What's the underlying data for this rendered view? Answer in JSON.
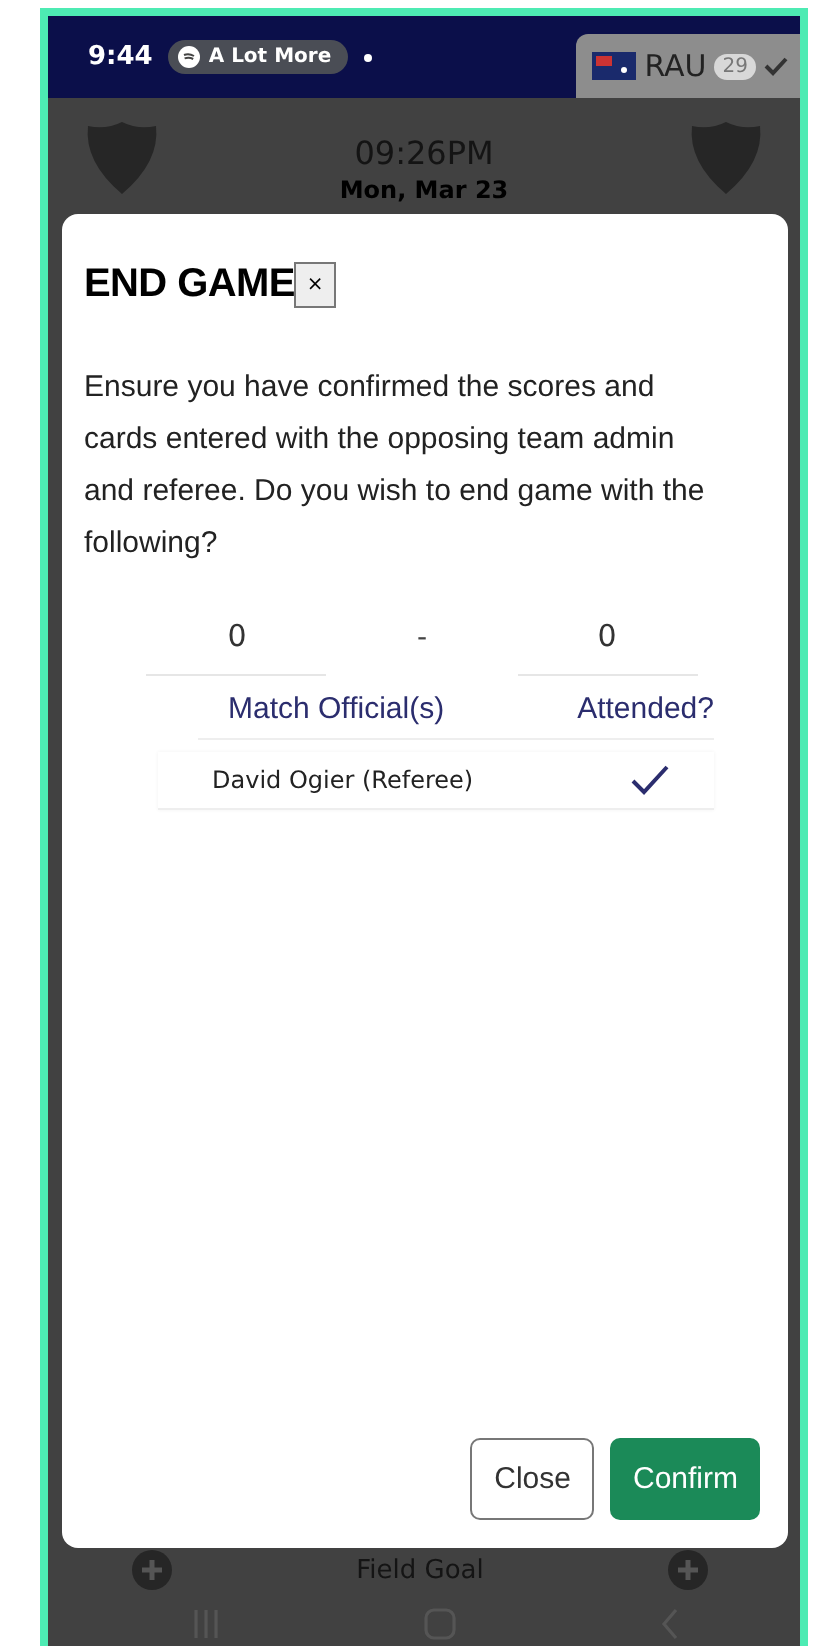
{
  "status_bar": {
    "time": "9:44",
    "media_pill": "A Lot More",
    "tab_label": "RAU",
    "badge": "29"
  },
  "match_header": {
    "kickoff_time": "09:26PM",
    "date": "Mon, Mar 23"
  },
  "dialog": {
    "title": "END GAME",
    "close_glyph": "×",
    "message": "Ensure you have confirmed the scores and cards entered with the opposing team admin and referee. Do you wish to end game with the following?",
    "score": {
      "home": "0",
      "separator": "-",
      "away": "0"
    },
    "officials_table": {
      "columns": [
        "Match Official(s)",
        "Attended?"
      ],
      "rows": [
        {
          "name": "David Ogier (Referee)",
          "attended": true
        }
      ]
    },
    "buttons": [
      {
        "label": "Close",
        "kind": "secondary"
      },
      {
        "label": "Confirm",
        "kind": "primary"
      }
    ]
  },
  "bottom_bar": {
    "label": "Field Goal"
  }
}
